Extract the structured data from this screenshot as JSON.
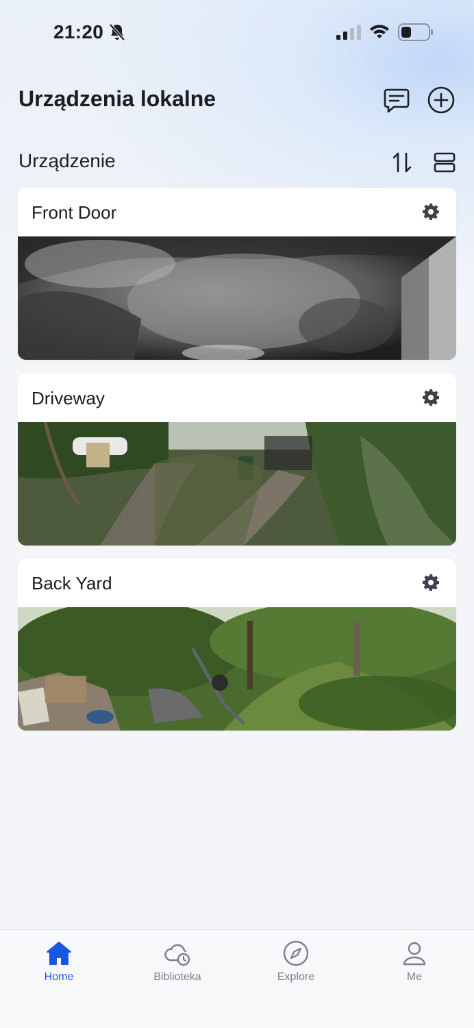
{
  "status_bar": {
    "time": "21:20",
    "icons": [
      "bell-off-icon",
      "signal-icon",
      "wifi-icon",
      "battery-icon"
    ]
  },
  "header": {
    "title": "Urządzenia lokalne",
    "actions": [
      "chat-icon",
      "plus-circle-icon"
    ]
  },
  "section": {
    "label": "Urządzenie",
    "actions": [
      "sort-icon",
      "layout-list-icon"
    ]
  },
  "devices": [
    {
      "name": "Front Door"
    },
    {
      "name": "Driveway"
    },
    {
      "name": "Back Yard"
    }
  ],
  "bottom_nav": {
    "items": [
      {
        "label": "Home",
        "icon": "home-icon",
        "active": true
      },
      {
        "label": "Biblioteka",
        "icon": "cloud-clock-icon",
        "active": false
      },
      {
        "label": "Explore",
        "icon": "compass-icon",
        "active": false
      },
      {
        "label": "Me",
        "icon": "person-icon",
        "active": false
      }
    ]
  },
  "colors": {
    "accent": "#1a55e3",
    "inactive": "#7b7e86",
    "background": "#f3f5f8"
  }
}
